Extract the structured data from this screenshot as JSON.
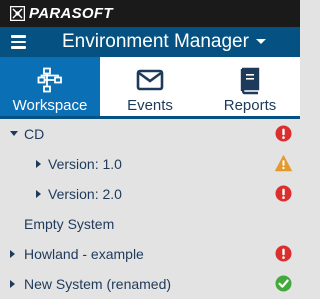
{
  "brand": {
    "name": "PARASOFT"
  },
  "header": {
    "title": "Environment Manager",
    "menu_icon": "hamburger-icon",
    "dropdown_icon": "caret-down-icon"
  },
  "tabs": [
    {
      "label": "Workspace",
      "icon": "workspace-icon",
      "active": true
    },
    {
      "label": "Events",
      "icon": "envelope-icon",
      "active": false
    },
    {
      "label": "Reports",
      "icon": "book-icon",
      "active": false
    }
  ],
  "tree": [
    {
      "label": "CD",
      "expanded": true,
      "status": "error"
    },
    {
      "label": "Version: 1.0",
      "expanded": false,
      "status": "warning"
    },
    {
      "label": "Version: 2.0",
      "expanded": false,
      "status": "error"
    },
    {
      "label": "Empty System",
      "status": "none"
    },
    {
      "label": "Howland - example",
      "expanded": false,
      "status": "error"
    },
    {
      "label": "New System (renamed)",
      "expanded": false,
      "status": "ok"
    }
  ],
  "colors": {
    "brand_bar": "#1a1a1a",
    "header": "#045182",
    "active_tab": "#0a6fb5",
    "error": "#d9302f",
    "warning": "#e39a2c",
    "ok": "#42a93a",
    "text": "#1e3a5a"
  }
}
